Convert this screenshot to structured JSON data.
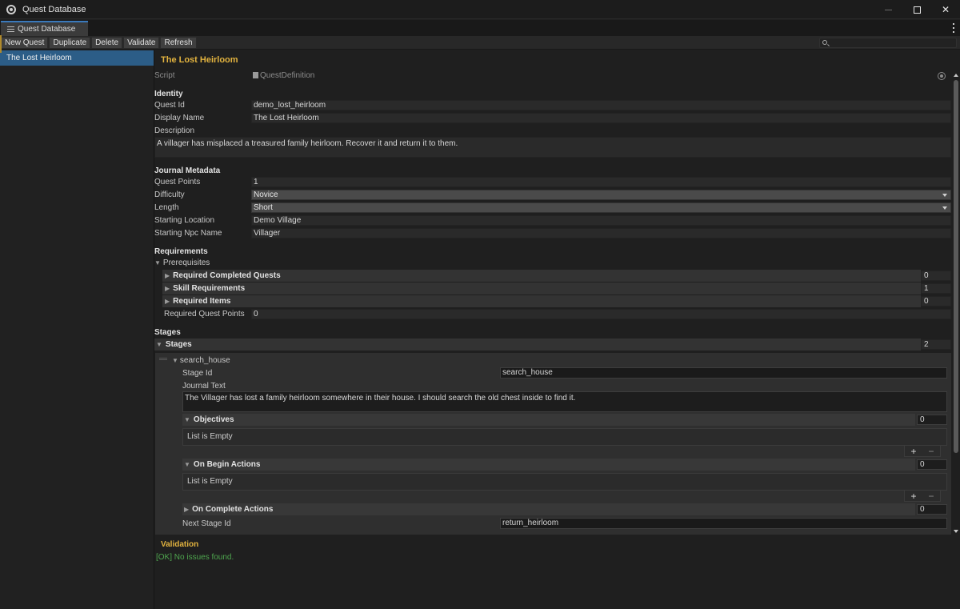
{
  "window": {
    "title": "Quest Database"
  },
  "tab": {
    "label": "Quest Database"
  },
  "toolbar": {
    "new_quest": "New Quest",
    "duplicate": "Duplicate",
    "delete": "Delete",
    "validate": "Validate",
    "refresh": "Refresh",
    "search_value": ""
  },
  "sidebar": {
    "items": [
      {
        "label": "The Lost Heirloom",
        "selected": true
      }
    ]
  },
  "inspector": {
    "title": "The Lost Heirloom",
    "script_label": "Script",
    "script_value": "QuestDefinition",
    "identity": {
      "header": "Identity",
      "quest_id_label": "Quest Id",
      "quest_id": "demo_lost_heirloom",
      "display_name_label": "Display Name",
      "display_name": "The Lost Heirloom",
      "description_label": "Description",
      "description": "A villager has misplaced a treasured family heirloom. Recover it and return it to them."
    },
    "journal": {
      "header": "Journal Metadata",
      "quest_points_label": "Quest Points",
      "quest_points": "1",
      "difficulty_label": "Difficulty",
      "difficulty": "Novice",
      "length_label": "Length",
      "length": "Short",
      "starting_location_label": "Starting Location",
      "starting_location": "Demo Village",
      "starting_npc_label": "Starting Npc Name",
      "starting_npc": "Villager"
    },
    "requirements": {
      "header": "Requirements",
      "prerequisites_label": "Prerequisites",
      "lists": [
        {
          "label": "Required Completed Quests",
          "count": "0"
        },
        {
          "label": "Skill Requirements",
          "count": "1"
        },
        {
          "label": "Required Items",
          "count": "0"
        }
      ],
      "required_qp_label": "Required Quest Points",
      "required_qp": "0"
    },
    "stages": {
      "header": "Stages",
      "list_label": "Stages",
      "count": "2",
      "stage": {
        "name": "search_house",
        "stage_id_label": "Stage Id",
        "stage_id": "search_house",
        "journal_text_label": "Journal Text",
        "journal_text": "The Villager has lost a family heirloom somewhere in their house. I should search the old chest inside to find it.",
        "objectives_label": "Objectives",
        "objectives_count": "0",
        "on_begin_label": "On Begin Actions",
        "on_begin_count": "0",
        "on_complete_label": "On Complete Actions",
        "on_complete_count": "0",
        "empty_text": "List is Empty",
        "next_stage_label": "Next Stage Id",
        "next_stage": "return_heirloom"
      }
    }
  },
  "validation": {
    "header": "Validation",
    "message": "[OK] No issues found."
  },
  "colors": {
    "accent": "#e2b33f",
    "selection": "#2c5d87",
    "ok": "#4ea54e",
    "tab_highlight": "#3a79bb"
  }
}
